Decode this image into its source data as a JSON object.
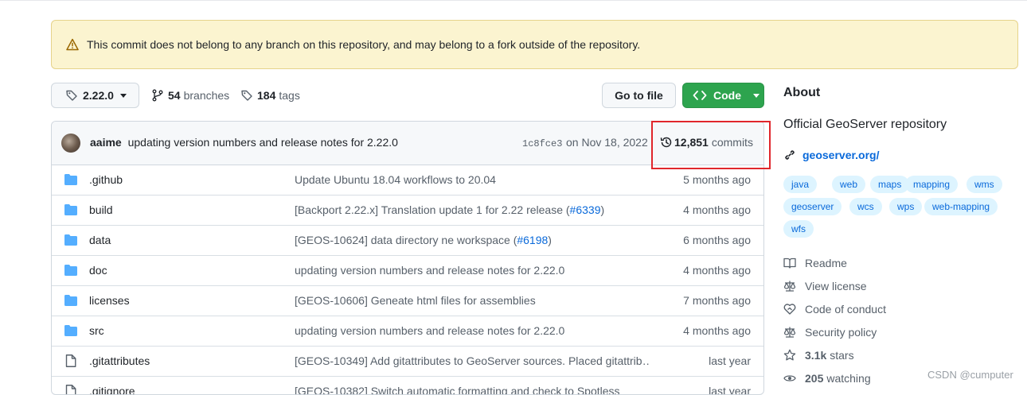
{
  "banner": {
    "icon": "alert-icon",
    "text": "This commit does not belong to any branch on this repository, and may belong to a fork outside of the repository."
  },
  "toolbar": {
    "branch_name": "2.22.0",
    "branches_count": "54",
    "branches_label": "branches",
    "tags_count": "184",
    "tags_label": "tags",
    "goto_label": "Go to file",
    "code_label": "Code"
  },
  "latest_commit": {
    "author": "aaime",
    "message": "updating version numbers and release notes for 2.22.0",
    "sha": "1c8fce3",
    "date": "on Nov 18, 2022",
    "commits_count": "12,851",
    "commits_label": "commits"
  },
  "files": [
    {
      "type": "dir",
      "name": ".github",
      "msg": "Update Ubuntu 18.04 workflows to 20.04",
      "pr": "",
      "tail": "",
      "age": "5 months ago"
    },
    {
      "type": "dir",
      "name": "build",
      "msg": "[Backport 2.22.x] Translation update 1 for 2.22 release (",
      "pr": "#6339",
      "tail": ")",
      "age": "4 months ago"
    },
    {
      "type": "dir",
      "name": "data",
      "msg": "[GEOS-10624] data directory ne workspace (",
      "pr": "#6198",
      "tail": ")",
      "age": "6 months ago"
    },
    {
      "type": "dir",
      "name": "doc",
      "msg": "updating version numbers and release notes for 2.22.0",
      "pr": "",
      "tail": "",
      "age": "4 months ago"
    },
    {
      "type": "dir",
      "name": "licenses",
      "msg": "[GEOS-10606] Geneate html files for assemblies",
      "pr": "",
      "tail": "",
      "age": "7 months ago"
    },
    {
      "type": "dir",
      "name": "src",
      "msg": "updating version numbers and release notes for 2.22.0",
      "pr": "",
      "tail": "",
      "age": "4 months ago"
    },
    {
      "type": "file",
      "name": ".gitattributes",
      "msg": "[GEOS-10349] Add gitattributes to GeoServer sources. Placed gitattrib…",
      "pr": "",
      "tail": "",
      "age": "last year"
    },
    {
      "type": "file",
      "name": ".gitignore",
      "msg": "[GEOS-10382] Switch automatic formatting and check to Spotless",
      "pr": "",
      "tail": "",
      "age": "last year"
    }
  ],
  "about": {
    "title": "About",
    "description": "Official GeoServer repository",
    "link": "geoserver.org/",
    "topics": [
      "java",
      "web",
      "maps",
      "mapping",
      "wms",
      "geoserver",
      "wcs",
      "wps",
      "web-mapping",
      "wfs"
    ],
    "readme": "Readme",
    "license": "View license",
    "conduct": "Code of conduct",
    "security": "Security policy",
    "stars_count": "3.1k",
    "stars_label": "stars",
    "watching_count": "205",
    "watching_label": "watching"
  },
  "watermark": "CSDN @cumputer",
  "colors": {
    "accent": "#0969da",
    "code_button": "#2da44e",
    "banner_bg": "#fbf4d0",
    "highlight_box": "#e0262b"
  }
}
